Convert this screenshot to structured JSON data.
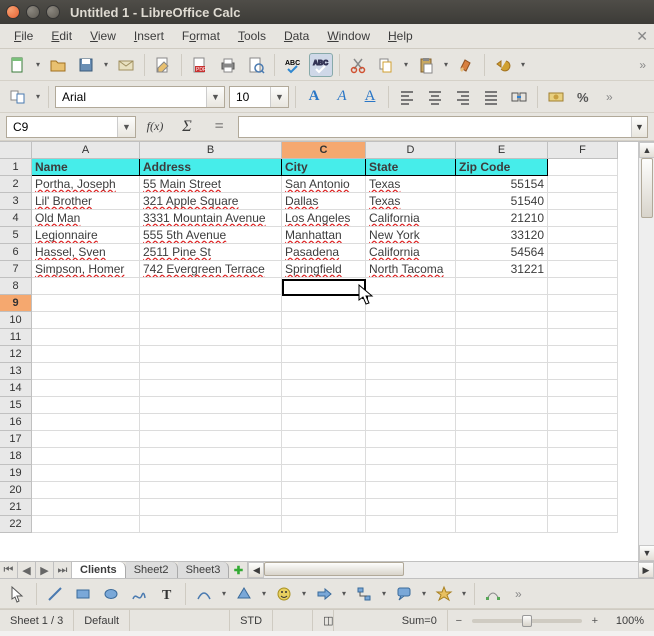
{
  "window": {
    "title": "Untitled 1 - LibreOffice Calc"
  },
  "menu": [
    "File",
    "Edit",
    "View",
    "Insert",
    "Format",
    "Tools",
    "Data",
    "Window",
    "Help"
  ],
  "font": {
    "name": "Arial",
    "size": "10"
  },
  "ref": {
    "cell": "C9"
  },
  "columns": [
    "A",
    "B",
    "C",
    "D",
    "E",
    "F"
  ],
  "selected_col": "C",
  "selected_row": 9,
  "headers": {
    "A": "Name",
    "B": "Address",
    "C": "City",
    "D": "State",
    "E": "Zip Code"
  },
  "rows": [
    {
      "A": "Portha, Joseph",
      "B": "55 Main Street",
      "C": "San Antonio",
      "D": "Texas",
      "E": "55154"
    },
    {
      "A": "Lil' Brother",
      "B": "321 Apple Square",
      "C": "Dallas",
      "D": "Texas",
      "E": "51540"
    },
    {
      "A": "Old Man",
      "B": "3331 Mountain Avenue",
      "C": "Los Angeles",
      "D": "California",
      "E": "21210"
    },
    {
      "A": "Legionnaire",
      "B": "555 5th Avenue",
      "C": "Manhattan",
      "D": "New York",
      "E": "33120"
    },
    {
      "A": "Hassel, Sven",
      "B": "2511 Pine St",
      "C": "Pasadena",
      "D": "California",
      "E": "54564"
    },
    {
      "A": "Simpson, Homer",
      "B": "742 Evergreen Terrace",
      "C": "Springfield",
      "D": "North Tacoma",
      "E": "31221"
    }
  ],
  "sheets": {
    "active": "Clients",
    "others": [
      "Sheet2",
      "Sheet3"
    ]
  },
  "status": {
    "sheet": "Sheet 1 / 3",
    "style": "Default",
    "mode": "STD",
    "sum": "Sum=0",
    "zoom": "100%"
  }
}
